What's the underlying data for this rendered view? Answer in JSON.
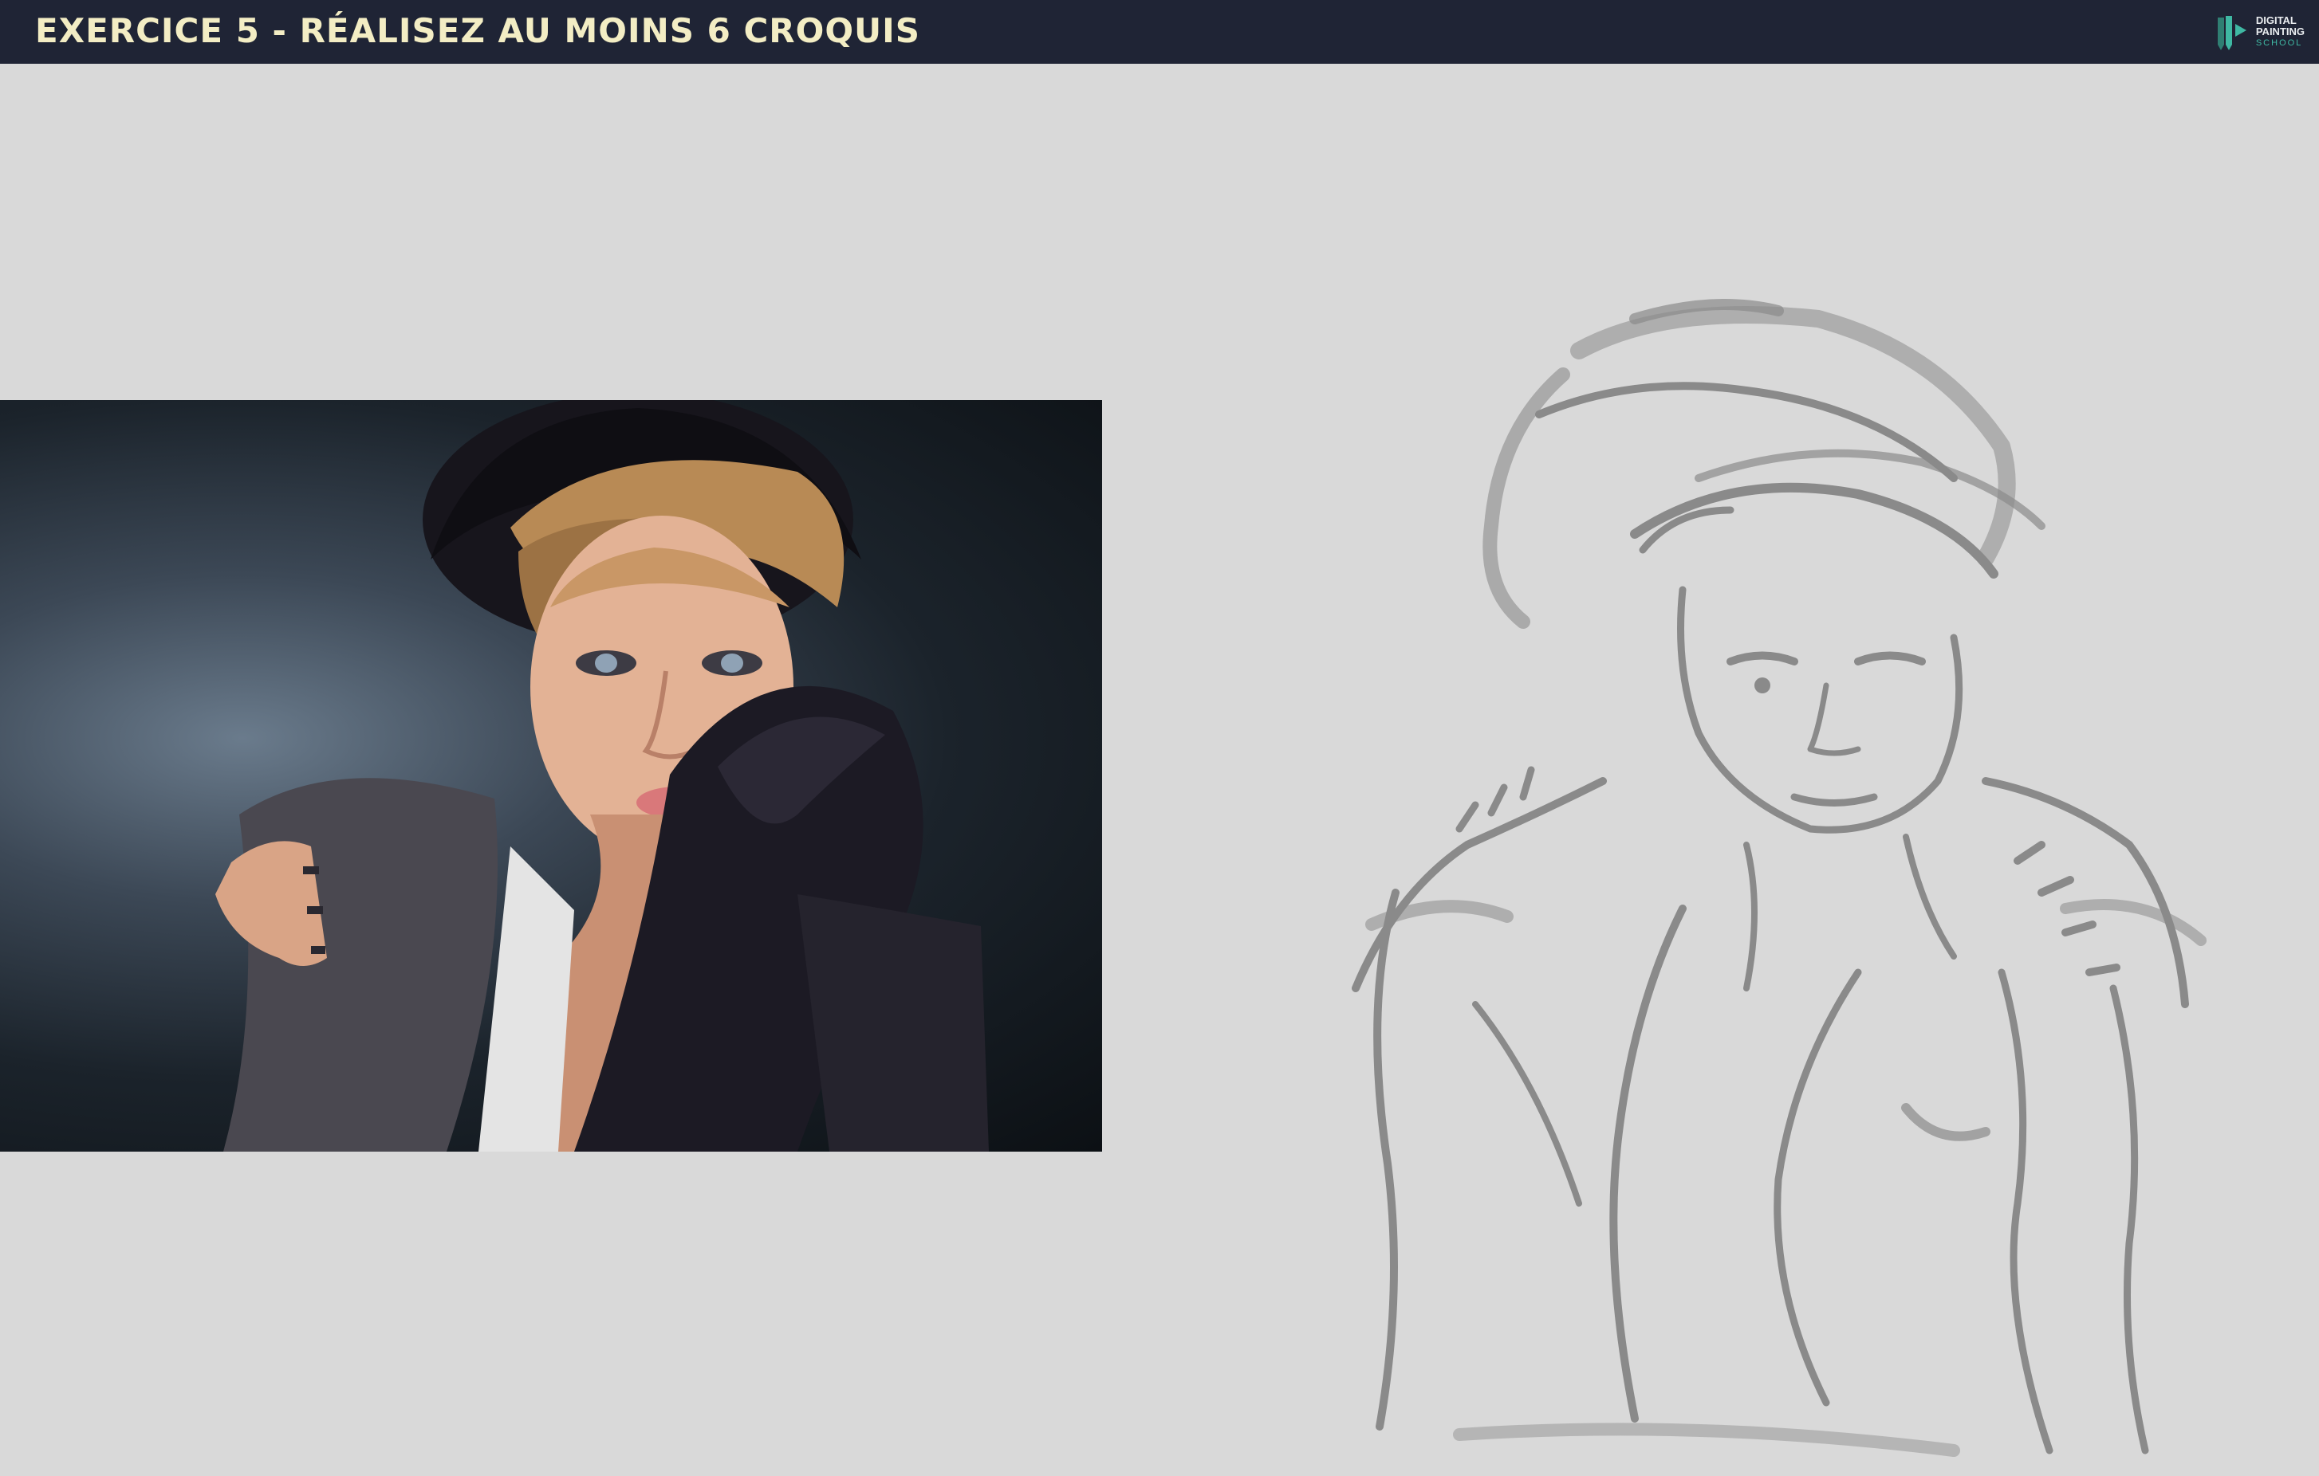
{
  "header": {
    "title": "EXERCICE 5 - RÉALISEZ AU MOINS 6 CROQUIS",
    "logo": {
      "line1": "DIGITAL",
      "line2": "PAINTING",
      "line3": "SCHOOL",
      "icon": "pencil-play-logo-icon"
    }
  },
  "colors": {
    "header_bg": "#1f2435",
    "title": "#f3edc4",
    "canvas_bg": "#d9d9d9",
    "logo_accent": "#3fb8a3",
    "sketch_stroke": "#8a8a8a"
  },
  "content": {
    "reference_photo": "reference-photo",
    "sketch": "gesture-sketch"
  }
}
